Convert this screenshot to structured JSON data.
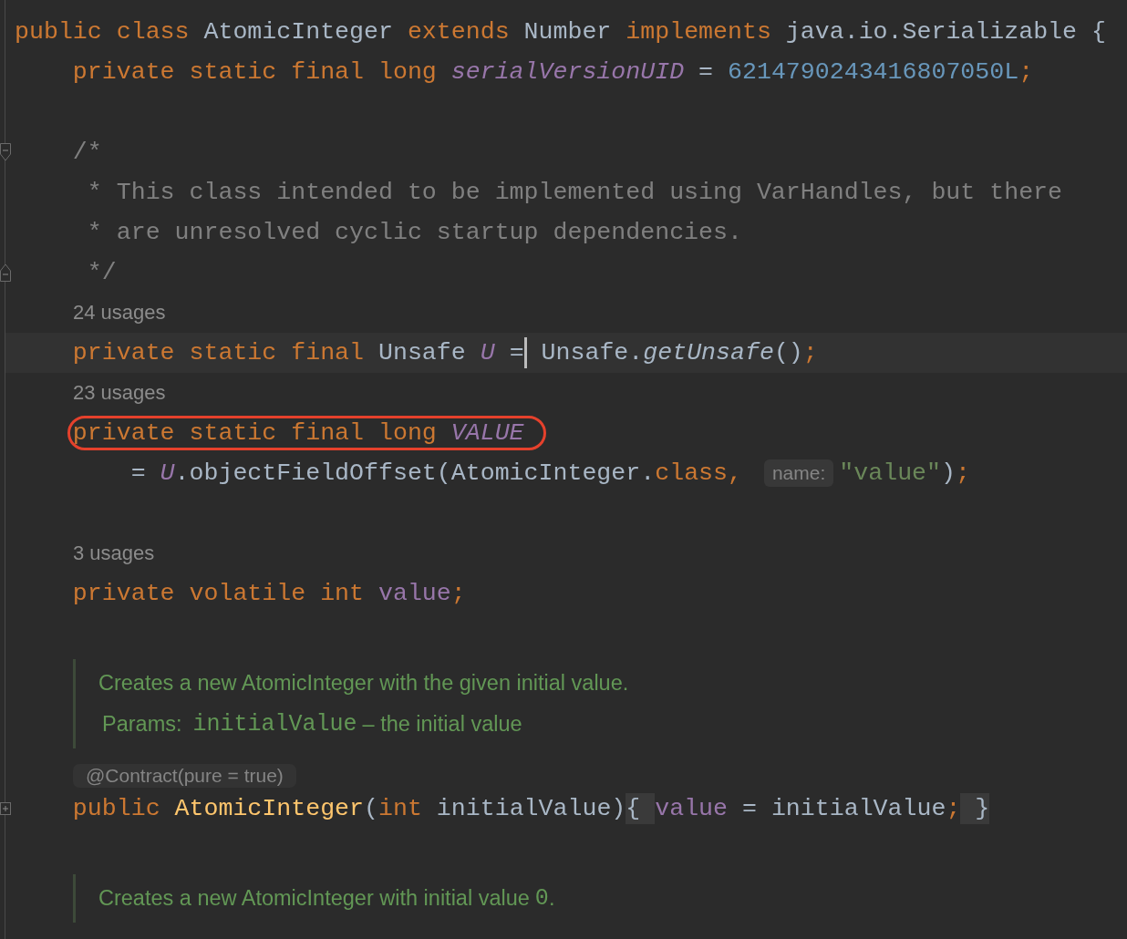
{
  "editor": {
    "lines": [
      {
        "kind": "code",
        "tokens": [
          {
            "kind": "keyword",
            "text": "public class "
          },
          {
            "kind": "plain",
            "text": "AtomicInteger "
          },
          {
            "kind": "keyword",
            "text": "extends "
          },
          {
            "kind": "plain",
            "text": "Number "
          },
          {
            "kind": "keyword",
            "text": "implements "
          },
          {
            "kind": "plain",
            "text": "java.io.Serializable {"
          }
        ]
      },
      {
        "kind": "code",
        "tokens": [
          {
            "kind": "keyword",
            "text": "    private static final long "
          },
          {
            "kind": "static-field",
            "text": "serialVersionUID"
          },
          {
            "kind": "plain",
            "text": " = "
          },
          {
            "kind": "number",
            "text": "6214790243416807050L"
          },
          {
            "kind": "punct",
            "text": ";"
          }
        ]
      },
      {
        "kind": "blank"
      },
      {
        "kind": "code",
        "fold": {
          "kind": "start"
        },
        "tokens": [
          {
            "kind": "comment",
            "text": "    /*"
          }
        ]
      },
      {
        "kind": "code",
        "tokens": [
          {
            "kind": "comment",
            "text": "     * This class intended to be implemented using VarHandles, but there"
          }
        ]
      },
      {
        "kind": "code",
        "tokens": [
          {
            "kind": "comment",
            "text": "     * are unresolved cyclic startup dependencies."
          }
        ]
      },
      {
        "kind": "code",
        "fold": {
          "kind": "end"
        },
        "tokens": [
          {
            "kind": "comment",
            "text": "     */"
          }
        ]
      },
      {
        "kind": "usages",
        "text": "24 usages"
      },
      {
        "kind": "code",
        "current": true,
        "tokens": [
          {
            "kind": "keyword",
            "text": "    private static final "
          },
          {
            "kind": "plain",
            "text": "Unsafe "
          },
          {
            "kind": "static-field",
            "text": "U"
          },
          {
            "kind": "plain",
            "text": " ="
          },
          {
            "kind": "caret"
          },
          {
            "kind": "plain",
            "text": " Unsafe."
          },
          {
            "kind": "static-method",
            "text": "getUnsafe"
          },
          {
            "kind": "plain",
            "text": "()"
          },
          {
            "kind": "punct",
            "text": ";"
          }
        ]
      },
      {
        "kind": "usages",
        "text": "23 usages"
      },
      {
        "kind": "code",
        "circled": true,
        "tokens": [
          {
            "kind": "keyword",
            "text": "    private static final long "
          },
          {
            "kind": "static-field",
            "text": "VALUE"
          }
        ]
      },
      {
        "kind": "code",
        "tokens": [
          {
            "kind": "plain",
            "text": "        = "
          },
          {
            "kind": "static-field",
            "text": "U"
          },
          {
            "kind": "plain",
            "text": ".objectFieldOffset(AtomicInteger."
          },
          {
            "kind": "keyword",
            "text": "class"
          },
          {
            "kind": "punct",
            "text": ", "
          },
          {
            "kind": "hint",
            "text": "name:"
          },
          {
            "kind": "string",
            "text": "\"value\""
          },
          {
            "kind": "plain",
            "text": ")"
          },
          {
            "kind": "punct",
            "text": ";"
          }
        ]
      },
      {
        "kind": "blank"
      },
      {
        "kind": "usages",
        "text": "3 usages"
      },
      {
        "kind": "code",
        "tokens": [
          {
            "kind": "keyword",
            "text": "    private volatile int "
          },
          {
            "kind": "field",
            "text": "value"
          },
          {
            "kind": "punct",
            "text": ";"
          }
        ]
      },
      {
        "kind": "doc",
        "rows": [
          [
            {
              "kind": "text",
              "text": "Creates a new AtomicInteger with the given initial value."
            }
          ],
          [
            {
              "kind": "label",
              "text": "Params:"
            },
            {
              "kind": "code",
              "text": "initialValue"
            },
            {
              "kind": "text",
              "text": "– the initial value"
            }
          ]
        ]
      },
      {
        "kind": "annotation",
        "text": "@Contract(pure = true)"
      },
      {
        "kind": "code",
        "fold": {
          "kind": "collapsed"
        },
        "tokens": [
          {
            "kind": "keyword",
            "text": "    public "
          },
          {
            "kind": "constructor",
            "text": "AtomicInteger"
          },
          {
            "kind": "plain",
            "text": "("
          },
          {
            "kind": "keyword",
            "text": "int "
          },
          {
            "kind": "plain",
            "text": "initialValue)"
          },
          {
            "kind": "folded",
            "text": "{ "
          },
          {
            "kind": "field",
            "text": "value"
          },
          {
            "kind": "plain",
            "text": " = initialValue"
          },
          {
            "kind": "punct",
            "text": ";"
          },
          {
            "kind": "folded",
            "text": " }"
          }
        ]
      },
      {
        "kind": "doc",
        "rows": [
          [
            {
              "kind": "text",
              "text": "Creates a new AtomicInteger with initial value"
            },
            {
              "kind": "code",
              "text": "0"
            },
            {
              "kind": "text",
              "text": "."
            }
          ]
        ]
      }
    ]
  }
}
